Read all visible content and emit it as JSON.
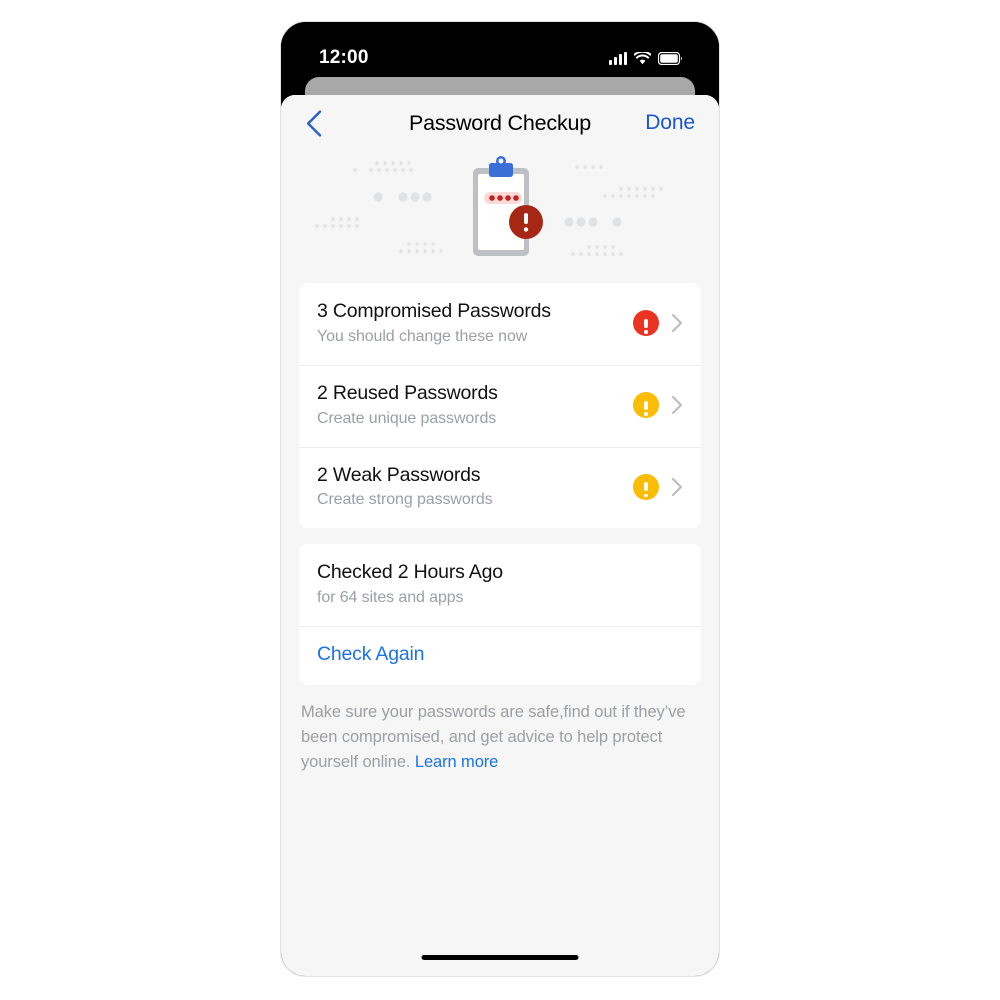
{
  "status_bar": {
    "time": "12:00",
    "signal_icon": "cellular-signal-icon",
    "wifi_icon": "wifi-icon",
    "battery_icon": "battery-full-icon"
  },
  "navbar": {
    "back_icon": "chevron-left-icon",
    "title": "Password Checkup",
    "done_label": "Done",
    "done_color": "#1A56D0"
  },
  "illustration": {
    "name": "clipboard-password-alert-illustration",
    "clip_color": "#3A6FD8",
    "board_color": "#BDC1C6",
    "paper_color": "#FFFFFF",
    "pill_color": "#FAD9D6",
    "dot_color": "#C5221F",
    "alert_color": "#A52714",
    "decoration_color": "#E0E2E4"
  },
  "issues": {
    "items": [
      {
        "title": "3 Compromised Passwords",
        "subtitle": "You should change these now",
        "badge": "alert-exclamation-icon",
        "badge_level": "red",
        "badge_color": "#EA3323",
        "chevron": "chevron-right-icon"
      },
      {
        "title": "2 Reused Passwords",
        "subtitle": "Create unique passwords",
        "badge": "alert-exclamation-icon",
        "badge_level": "amber",
        "badge_color": "#FBBC04",
        "chevron": "chevron-right-icon"
      },
      {
        "title": "2 Weak Passwords",
        "subtitle": "Create strong passwords",
        "badge": "alert-exclamation-icon",
        "badge_level": "amber",
        "badge_color": "#FBBC04",
        "chevron": "chevron-right-icon"
      }
    ]
  },
  "status_card": {
    "title": "Checked 2 Hours Ago",
    "subtitle": "for 64 sites and apps",
    "action_label": "Check Again",
    "action_color": "#1A73E8"
  },
  "footnote": {
    "text": "Make sure your passwords are safe,find out if they’ve been compromised, and get advice to help protect yourself online. ",
    "link_label": "Learn more",
    "link_color": "#1A73E8"
  },
  "home_indicator": "home-indicator"
}
